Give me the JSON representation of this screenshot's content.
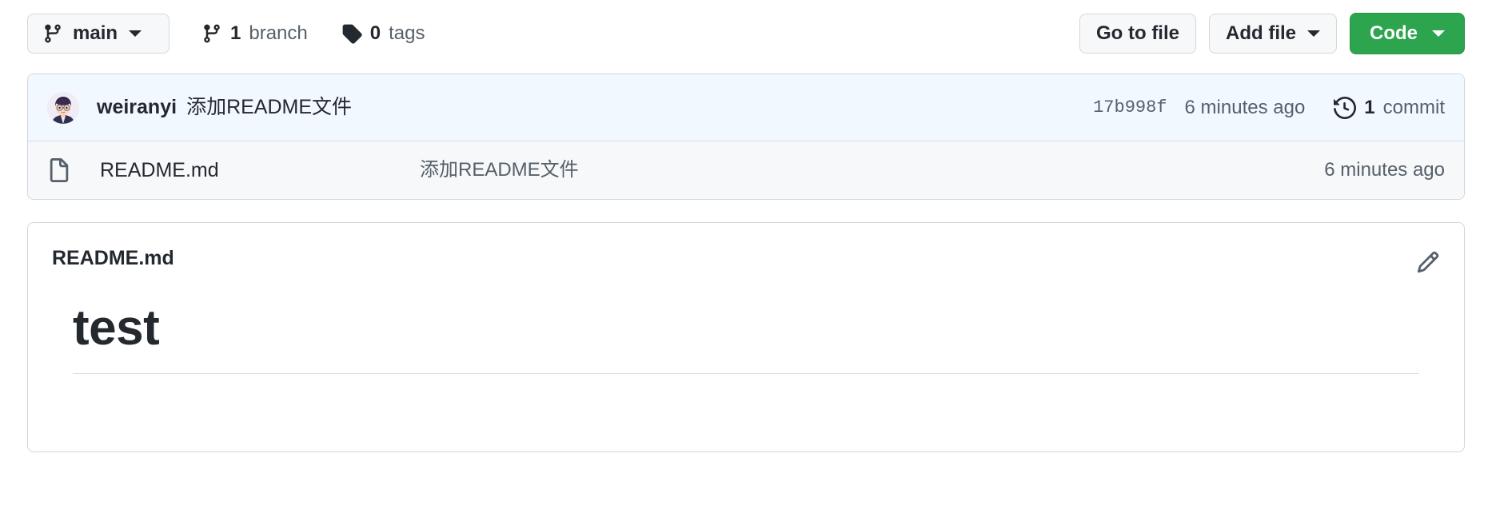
{
  "toolbar": {
    "branch_selector": {
      "label": "main",
      "icon": "git-branch-icon",
      "caret": "chevron-down-icon"
    },
    "branch_count": {
      "count": "1",
      "label": "branch",
      "icon": "git-branch-icon"
    },
    "tag_count": {
      "count": "0",
      "label": "tags",
      "icon": "tag-icon"
    },
    "go_to_file_label": "Go to file",
    "add_file_label": "Add file",
    "code_label": "Code"
  },
  "commit_row": {
    "avatar_name": "weiranyi-avatar",
    "author": "weiranyi",
    "message": "添加README文件",
    "sha": "17b998f",
    "time": "6 minutes ago",
    "commit_count": "1",
    "commit_count_label": "commit",
    "history_icon": "history-clock-icon"
  },
  "file_list": {
    "rows": [
      {
        "icon": "file-icon",
        "name": "README.md",
        "commit_message": "添加README文件",
        "time": "6 minutes ago"
      }
    ]
  },
  "readme": {
    "title": "README.md",
    "edit_icon": "pencil-icon",
    "heading": "test"
  },
  "colors": {
    "accent": "#0969da",
    "primary_button": "#2da44e",
    "commit_row_bg": "#f1f8ff",
    "file_row_bg": "#f6f8fa",
    "border": "#d0d7de",
    "muted_text": "#57606a",
    "text": "#24292f"
  }
}
